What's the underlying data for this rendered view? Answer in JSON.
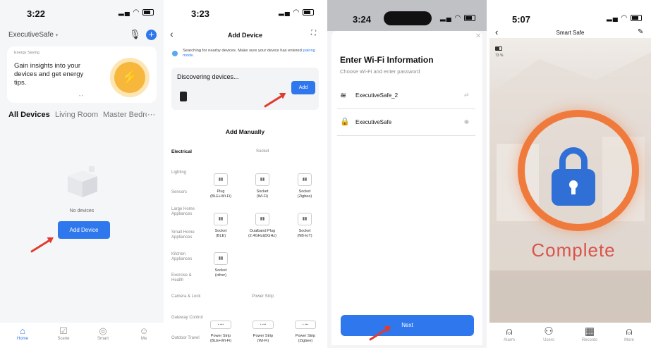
{
  "panel1": {
    "time": "3:22",
    "home_name": "ExecutiveSafe",
    "banner_tag": "Energy Saving",
    "banner_text": "Gain insights into your devices and get energy tips.",
    "tabs": [
      "All Devices",
      "Living Room",
      "Master Bedroo"
    ],
    "more_glyph": "···",
    "empty_text": "No devices",
    "add_device_btn": "Add Device",
    "nav": [
      "Home",
      "Scene",
      "Smart",
      "Me"
    ]
  },
  "panel2": {
    "time": "3:23",
    "title": "Add Device",
    "searching_text": "Searching for nearby devices. Make sure your device has entered",
    "pairing_link": "pairing mode.",
    "discovering": "Discovering devices...",
    "add_btn": "Add",
    "add_manually": "Add Manually",
    "active_category": "Electrical",
    "section_socket": "Socket",
    "section_power_strip": "Power Strip",
    "categories": [
      "Lighting",
      "Sensors",
      "Large Home Appliances",
      "Small Home Appliances",
      "Kitchen Appliances",
      "Exercise & Health",
      "Camera & Lock",
      "Gateway Control",
      "Outdoor Travel"
    ],
    "sockets_row1": [
      {
        "name": "Plug",
        "sub": "(BLE+Wi-Fi)"
      },
      {
        "name": "Socket",
        "sub": "(Wi-Fi)"
      },
      {
        "name": "Socket",
        "sub": "(Zigbee)"
      }
    ],
    "sockets_row2": [
      {
        "name": "Socket",
        "sub": "(BLE)"
      },
      {
        "name": "Dualband Plug",
        "sub": "(2.4GHz&5GHz)"
      },
      {
        "name": "Socket",
        "sub": "(NB-IoT)"
      }
    ],
    "socket_other": {
      "name": "Socket",
      "sub": "(other)"
    },
    "strips": [
      {
        "name": "Power Strip",
        "sub": "(BLE+Wi-Fi)"
      },
      {
        "name": "Power Strip",
        "sub": "(Wi-Fi)"
      },
      {
        "name": "Power Strip",
        "sub": "(Zigbee)"
      }
    ]
  },
  "panel3": {
    "time": "3:24",
    "title": "Enter Wi-Fi Information",
    "subtitle": "Choose Wi-Fi and enter password",
    "wifi_name": "ExecutiveSafe_2",
    "password_value": "ExecutiveSafe",
    "next_btn": "Next"
  },
  "panel4": {
    "time": "5:07",
    "title": "Smart Safe",
    "battery_level": "73 %",
    "complete_text": "Complete",
    "nav": [
      "Alarm",
      "Users",
      "Records",
      "More"
    ]
  },
  "colors": {
    "primary_blue": "#2f77ec",
    "arrow_red": "#e23b2e",
    "lock_blue": "#2f6fd6",
    "ring_orange": "#ef7a3c",
    "complete_red": "#d9534a"
  }
}
